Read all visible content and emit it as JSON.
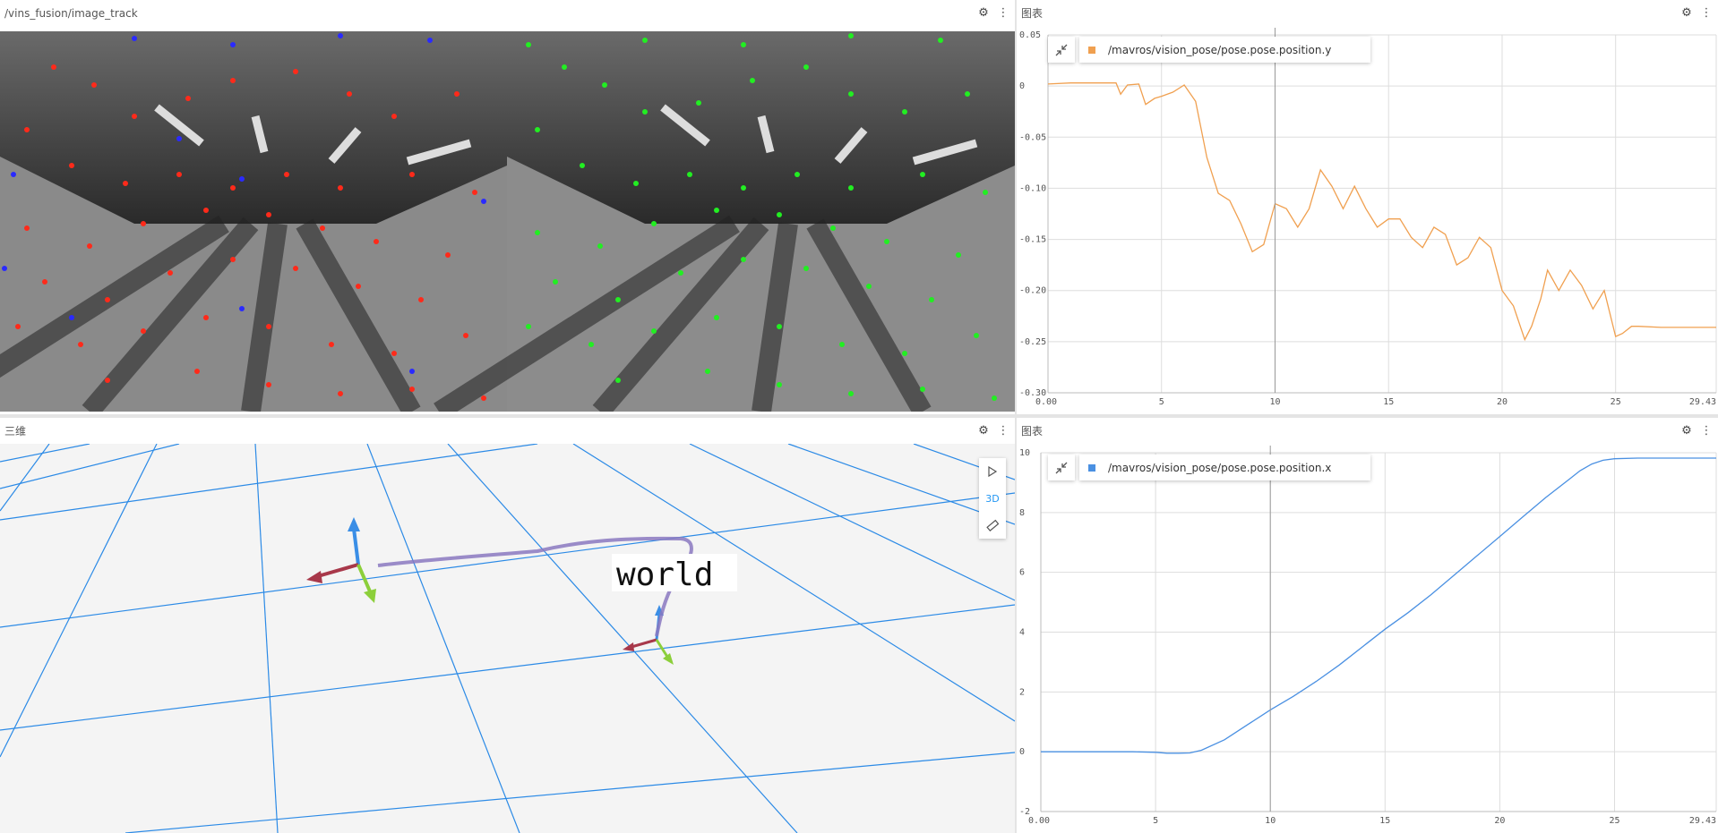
{
  "panels": {
    "image": {
      "title": "/vins_fusion/image_track"
    },
    "plot_y": {
      "title": "图表",
      "legend": "/mavros/vision_pose/pose.pose.position.y",
      "color": "#f0a050"
    },
    "three_d": {
      "title": "三维",
      "tool_3d": "3D",
      "frame_label": "world"
    },
    "plot_x": {
      "title": "图表",
      "legend": "/mavros/vision_pose/pose.pose.position.x",
      "color": "#4a90e2"
    }
  },
  "icons": {
    "settings": "gear-icon",
    "menu": "kebab-menu-icon",
    "collapse": "collapse-arrows-icon",
    "select": "cursor-icon",
    "measure": "ruler-icon"
  },
  "chart_data": [
    {
      "type": "line",
      "title": "",
      "series": [
        {
          "name": "/mavros/vision_pose/pose.pose.position.y",
          "x": [
            0,
            1,
            2,
            3,
            3.2,
            3.5,
            4,
            4.3,
            4.7,
            5,
            5.5,
            6,
            6.5,
            7,
            7.5,
            8,
            8.5,
            9,
            9.5,
            10,
            10.5,
            11,
            11.5,
            12,
            12.5,
            13,
            13.5,
            14,
            14.5,
            15,
            15.5,
            16,
            16.5,
            17,
            17.5,
            18,
            18.5,
            19,
            19.5,
            20,
            20.5,
            21,
            21.3,
            21.7,
            22,
            22.5,
            23,
            23.5,
            24,
            24.5,
            25,
            25.3,
            25.7,
            26,
            27,
            28,
            29.43
          ],
          "y": [
            0.002,
            0.003,
            0.003,
            0.003,
            -0.008,
            0.001,
            0.002,
            -0.018,
            -0.012,
            -0.01,
            -0.006,
            0.001,
            -0.015,
            -0.07,
            -0.105,
            -0.112,
            -0.135,
            -0.162,
            -0.155,
            -0.115,
            -0.12,
            -0.138,
            -0.12,
            -0.082,
            -0.098,
            -0.12,
            -0.098,
            -0.12,
            -0.138,
            -0.13,
            -0.13,
            -0.148,
            -0.158,
            -0.138,
            -0.145,
            -0.175,
            -0.168,
            -0.148,
            -0.158,
            -0.2,
            -0.215,
            -0.248,
            -0.235,
            -0.208,
            -0.18,
            -0.2,
            -0.18,
            -0.195,
            -0.218,
            -0.2,
            -0.245,
            -0.242,
            -0.235,
            -0.235,
            -0.236,
            -0.236,
            -0.236
          ]
        }
      ],
      "x_ticks": [
        "0.00",
        "5",
        "10",
        "15",
        "20",
        "25",
        "29.43"
      ],
      "y_ticks": [
        "0.05",
        "0",
        "-0.05",
        "-0.10",
        "-0.15",
        "-0.20",
        "-0.25",
        "-0.30"
      ],
      "xlim": [
        0,
        29.43
      ],
      "ylim": [
        -0.3,
        0.05
      ],
      "grid": true,
      "legend_position": "top-left"
    },
    {
      "type": "line",
      "title": "",
      "series": [
        {
          "name": "/mavros/vision_pose/pose.pose.position.x",
          "x": [
            0,
            2,
            4,
            5,
            5.5,
            6,
            6.5,
            7,
            8,
            9,
            10,
            11,
            12,
            13,
            14,
            15,
            16,
            17,
            18,
            19,
            20,
            21,
            22,
            23,
            23.5,
            24,
            24.5,
            25,
            26,
            27,
            28,
            29.43
          ],
          "y": [
            0,
            0,
            0,
            -0.02,
            -0.05,
            -0.05,
            -0.04,
            0.05,
            0.4,
            0.9,
            1.4,
            1.85,
            2.35,
            2.9,
            3.5,
            4.1,
            4.65,
            5.25,
            5.9,
            6.55,
            7.2,
            7.85,
            8.5,
            9.1,
            9.4,
            9.62,
            9.75,
            9.8,
            9.82,
            9.82,
            9.82,
            9.82
          ]
        }
      ],
      "x_ticks": [
        "0.00",
        "5",
        "10",
        "15",
        "20",
        "25",
        "29.43"
      ],
      "y_ticks": [
        "10",
        "8",
        "6",
        "4",
        "2",
        "0",
        "-2"
      ],
      "xlim": [
        0,
        29.43
      ],
      "ylim": [
        -2,
        10
      ],
      "grid": true,
      "legend_position": "top-left"
    }
  ]
}
